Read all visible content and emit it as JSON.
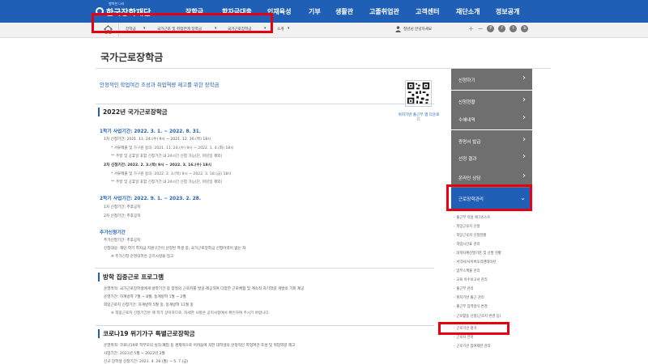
{
  "logo": {
    "sub": "행복한 나라",
    "text": "한국장학재단"
  },
  "menu": [
    "장학금",
    "학자금대출",
    "인재육성",
    "기부",
    "생활관",
    "고졸취업관",
    "고객센터",
    "재단소개",
    "정보공개"
  ],
  "breadcrumb": [
    "장학금",
    "국가근로 및 취업연계 장학금",
    "국가근로장학금",
    "소개"
  ],
  "greeting": "청년님 안녕하세요",
  "tools": {
    "plus": "+",
    "minus": "−",
    "icons": [
      "P",
      "f",
      "t",
      "b"
    ]
  },
  "page_title": "국가근로장학금",
  "intro": "안정적인 학업여건 조성과 취업역량 제고를 위한 장학금",
  "qr_caption": "위치기반 출근부 앱 다운로드",
  "section1": {
    "title": "2022년 국가근로장학금",
    "period1": "1학기 사업기간: 2022. 3. 1. ~ 2022. 8. 31.",
    "lines1": [
      "1차 신청기간: 2021. 11. 24.(수) 9시 ~ 2021. 12. 30.(목) 18시",
      "* 서류제출 및 가구원 동의: 2021. 11. 24.(수) 9시 ~ 2022. 1. 4.(화) 18시",
      "** 주말 및 공휴일 포함 신청기간 내 24시간 신청 가능(단, 마감일 제외)",
      "2차 신청기간: 2022. 2. 3.(목) 9시 ~ 2022. 3. 16.(수) 18시",
      "* 서류제출 및 가구원 동의: 2022. 2. 3.(목) 9시 ~ 2022. 3. 18.(금) 18시",
      "** 주말 및 공휴일 포함 신청기간 내 24시간 신청 가능(단, 마감일 제외)"
    ],
    "period2": "2학기 사업기간: 2022. 9. 1. ~ 2023. 2. 28.",
    "lines2": [
      "1차 신청기간: 추후공지",
      "2차 신청기간: 추후공지"
    ],
    "extra_title": "추가신청기간",
    "extra_lines": [
      "추가신청기간: 추후공지",
      "신청대상: 해당 학기 학자금 지원구간이 산정된 학생 중, 국가근로장학금 신청이력이 없는 자",
      "※ 추가신청 운영대학은 공지사항을 참고"
    ]
  },
  "section2": {
    "title": "방학 집중근로 프로그램",
    "lines": [
      "운영목적: 국가근로장학생에게 방학기간 중 양질의 근로지를 발굴·제공하여 다양한 근로체험 및 계속적 자기역량 개발의 기회 제공",
      "운영기간: 하계방학 7월 ~ 8월, 동계방학 1월 ~ 2월",
      "희망근로지 신청기간: 하계방학 5월 중, 동계방학 11월 중",
      "※ 희망근로지 신청기간은 매 학기 상이하므로, 자세한 사항은 공지사항에서 확인하여 주시기 바랍니다."
    ]
  },
  "section3": {
    "title": "코로나19 위기가구 특별근로장학금",
    "lines": [
      "운영목적: 코로나19로 학부모의 실직·폐업 등 경제적으로 어려움에 처한 대학생의 안정적인 학업여건 조성 및 취업역량 제고",
      "사업기간: 2021년 5월 ~ 2022년 2월",
      "신규 장학생 신청기간: 2021. 4. 26.(월) ~ 5. 7.(금)"
    ]
  },
  "sidebar": {
    "items": [
      "신청하기",
      "신청현황",
      "수혜내역",
      "증명서 발급",
      "선정 결과",
      "온라인 상담",
      "근로장학관리"
    ],
    "sub_items": [
      "출근부 작성 체크리스트",
      "희망근로지 신청",
      "희망근로지 신청현황",
      "학업시간표 관리",
      "대학자체선발기준 및 선발 현황",
      "서약서/사이버오리엔테이션",
      "업무스케줄 관리",
      "교육 이수보고서 관리",
      "출근부 관리",
      "위치기반 출근 관리",
      "출근부 입력방식 변경",
      "근로활동 신청(근로지 변경 등)",
      "근로기관 평가",
      "근로지 전학",
      "근로기관 참여제한 관리"
    ]
  },
  "colors": {
    "brand": "#1f5fb5",
    "highlight": "#e60012",
    "sidebar": "#6f6f6f"
  }
}
